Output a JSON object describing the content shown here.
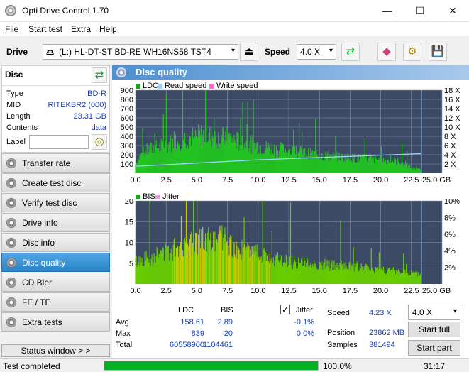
{
  "window": {
    "title": "Opti Drive Control 1.70",
    "minimize": "—",
    "maximize": "☐",
    "close": "✕"
  },
  "menu": {
    "file": "File",
    "start_test": "Start test",
    "extra": "Extra",
    "help": "Help"
  },
  "toolbar": {
    "drive_label": "Drive",
    "drive_value": "(L:)  HL-DT-ST BD-RE  WH16NS58 TST4",
    "speed_label": "Speed",
    "speed_value": "4.0 X"
  },
  "disc": {
    "header": "Disc",
    "type_label": "Type",
    "type_value": "BD-R",
    "mid_label": "MID",
    "mid_value": "RITEKBR2 (000)",
    "length_label": "Length",
    "length_value": "23.31 GB",
    "contents_label": "Contents",
    "contents_value": "data",
    "label_label": "Label",
    "label_value": ""
  },
  "nav": [
    "Transfer rate",
    "Create test disc",
    "Verify test disc",
    "Drive info",
    "Disc info",
    "Disc quality",
    "CD Bler",
    "FE / TE",
    "Extra tests"
  ],
  "nav_active": "Disc quality",
  "status_window": "Status window > >",
  "panel_title": "Disc quality",
  "chart_data": [
    {
      "type": "area",
      "legend": [
        "LDC",
        "Read speed",
        "Write speed"
      ],
      "legend_colors": [
        "#1f9f1f",
        "#9fd3ff",
        "#ff70d0"
      ],
      "xlim": [
        0,
        25
      ],
      "x_ticks": [
        "0.0",
        "2.5",
        "5.0",
        "7.5",
        "10.0",
        "12.5",
        "15.0",
        "17.5",
        "20.0",
        "22.5",
        "25.0 GB"
      ],
      "ylim": [
        0,
        900
      ],
      "y_ticks": [
        "100",
        "200",
        "300",
        "400",
        "500",
        "600",
        "700",
        "800",
        "900"
      ],
      "y2_ticks": [
        "2 X",
        "4 X",
        "6 X",
        "8 X",
        "10 X",
        "12 X",
        "14 X",
        "16 X",
        "18 X"
      ],
      "ldc_profile": [
        [
          0,
          110
        ],
        [
          0.5,
          230
        ],
        [
          1,
          280
        ],
        [
          2,
          320
        ],
        [
          3,
          370
        ],
        [
          4,
          420
        ],
        [
          5,
          440
        ],
        [
          5.5,
          470
        ],
        [
          6,
          460
        ],
        [
          7,
          420
        ],
        [
          7.5,
          440
        ],
        [
          8,
          400
        ],
        [
          9,
          360
        ],
        [
          10,
          330
        ],
        [
          11,
          300
        ],
        [
          12,
          280
        ],
        [
          13,
          260
        ],
        [
          14,
          240
        ],
        [
          15,
          220
        ],
        [
          16,
          200
        ],
        [
          17,
          190
        ],
        [
          18,
          180
        ],
        [
          19,
          170
        ],
        [
          20,
          160
        ],
        [
          21,
          150
        ],
        [
          22,
          120
        ],
        [
          22.5,
          60
        ],
        [
          23.3,
          40
        ]
      ],
      "read_speed_profile": [
        [
          0,
          1.5
        ],
        [
          5,
          2.2
        ],
        [
          10,
          2.9
        ],
        [
          15,
          3.4
        ],
        [
          20,
          3.9
        ],
        [
          23.3,
          4.23
        ]
      ],
      "disc_end": 23.31
    },
    {
      "type": "area",
      "legend": [
        "BIS",
        "Jitter"
      ],
      "legend_colors": [
        "#1f9f1f",
        "#e0a0e0"
      ],
      "xlim": [
        0,
        25
      ],
      "x_ticks": [
        "0.0",
        "2.5",
        "5.0",
        "7.5",
        "10.0",
        "12.5",
        "15.0",
        "17.5",
        "20.0",
        "22.5",
        "25.0 GB"
      ],
      "ylim": [
        0,
        20
      ],
      "y_ticks": [
        "5",
        "10",
        "15",
        "20"
      ],
      "y2_ticks": [
        "2%",
        "4%",
        "6%",
        "8%",
        "10%"
      ],
      "bis_profile": [
        [
          0,
          6
        ],
        [
          1,
          7
        ],
        [
          2,
          8
        ],
        [
          3,
          9
        ],
        [
          4,
          10
        ],
        [
          5,
          11
        ],
        [
          6,
          12
        ],
        [
          7,
          12
        ],
        [
          7.5,
          11
        ],
        [
          8,
          10
        ],
        [
          9,
          9
        ],
        [
          10,
          8
        ],
        [
          11,
          7
        ],
        [
          12,
          6.5
        ],
        [
          13,
          6
        ],
        [
          14,
          5.5
        ],
        [
          15,
          5.2
        ],
        [
          16,
          5
        ],
        [
          17,
          4.8
        ],
        [
          18,
          4.5
        ],
        [
          19,
          4.2
        ],
        [
          20,
          4
        ],
        [
          21,
          3.5
        ],
        [
          22,
          3
        ],
        [
          23.3,
          2.5
        ]
      ],
      "disc_end": 23.31
    }
  ],
  "stats": {
    "col_ldc": "LDC",
    "col_bis": "BIS",
    "jitter_label": "Jitter",
    "jitter_checked": true,
    "avg_label": "Avg",
    "avg_ldc": "158.61",
    "avg_bis": "2.89",
    "avg_jitter": "-0.1%",
    "max_label": "Max",
    "max_ldc": "839",
    "max_bis": "20",
    "max_jitter": "0.0%",
    "total_label": "Total",
    "total_ldc": "60558900",
    "total_bis": "1104461",
    "speed_label": "Speed",
    "speed_value": "4.23 X",
    "speed_select": "4.0 X",
    "position_label": "Position",
    "position_value": "23862 MB",
    "samples_label": "Samples",
    "samples_value": "381494",
    "start_full": "Start full",
    "start_part": "Start part"
  },
  "status": {
    "text": "Test completed",
    "progress_fraction": 1.0,
    "progress_text": "100.0%",
    "time": "31:17"
  }
}
